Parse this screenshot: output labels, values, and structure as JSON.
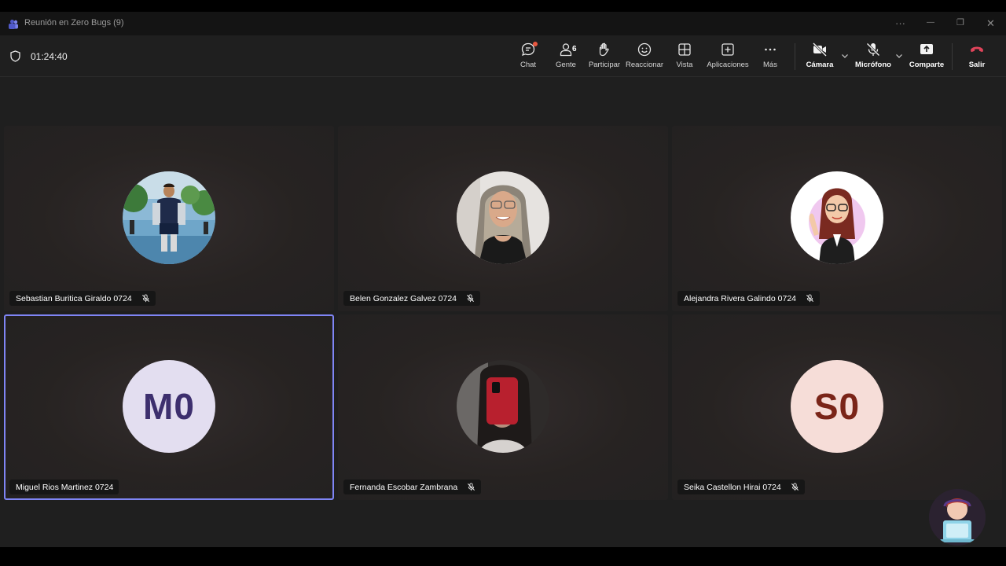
{
  "window": {
    "title": "Reunión en Zero Bugs (9)",
    "more_label": "···",
    "minimize_label": "—",
    "restore_label": "❐",
    "close_label": "✕"
  },
  "toolbar": {
    "timer": "01:24:40",
    "people_count": "6",
    "buttons": {
      "chat": "Chat",
      "people": "Gente",
      "raise": "Participar",
      "react": "Reaccionar",
      "view": "Vista",
      "apps": "Aplicaciones",
      "more": "Más",
      "camera": "Cámara",
      "mic": "Micrófono",
      "share": "Comparte",
      "leave": "Salir"
    }
  },
  "participants": [
    {
      "name": "Sebastian Buritica Giraldo 0724",
      "avatar_type": "photo",
      "muted": true
    },
    {
      "name": "Belen Gonzalez Galvez 0724",
      "avatar_type": "photo",
      "muted": true
    },
    {
      "name": "Alejandra Rivera Galindo 0724",
      "avatar_type": "illustration",
      "muted": true
    },
    {
      "name": "Miguel Rios Martinez 0724",
      "avatar_type": "initials",
      "initials": "M0",
      "avatar_bg": "#e3def0",
      "initials_color": "#3d2f6e",
      "muted": false,
      "active_speaker": true
    },
    {
      "name": "Fernanda Escobar Zambrana",
      "avatar_type": "photo",
      "muted": true
    },
    {
      "name": "Seika Castellon Hirai 0724",
      "avatar_type": "initials",
      "initials": "S0",
      "avatar_bg": "#f6ddd8",
      "initials_color": "#7a2418",
      "muted": true
    }
  ],
  "colors": {
    "accent": "#7f85f5",
    "leave": "#e0445a",
    "notification": "#e9573f"
  }
}
